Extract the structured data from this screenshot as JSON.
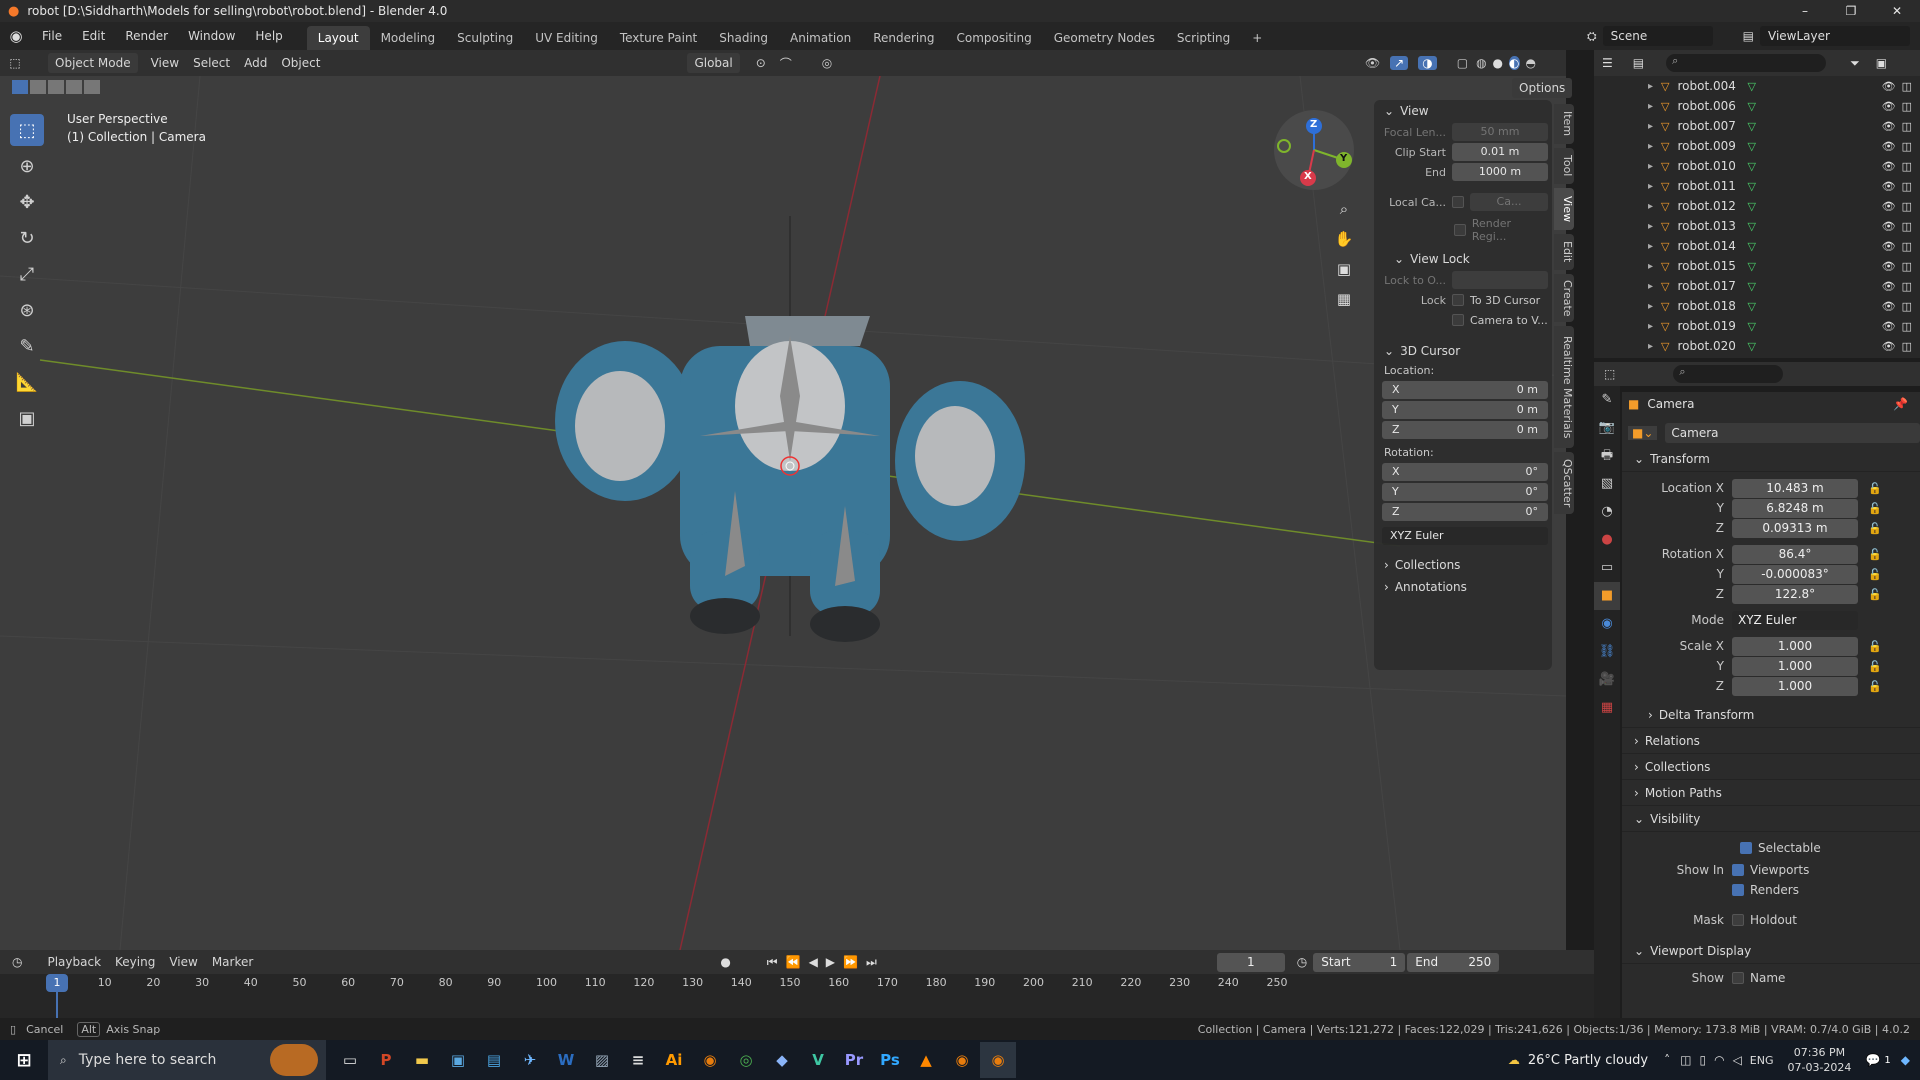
{
  "window": {
    "title": "robot [D:\\Siddharth\\Models for selling\\robot\\robot.blend] - Blender 4.0",
    "minimize": "–",
    "maximize": "❐",
    "close": "✕"
  },
  "menu": {
    "items": [
      "File",
      "Edit",
      "Render",
      "Window",
      "Help"
    ]
  },
  "workspaces": [
    "Layout",
    "Modeling",
    "Sculpting",
    "UV Editing",
    "Texture Paint",
    "Shading",
    "Animation",
    "Rendering",
    "Compositing",
    "Geometry Nodes",
    "Scripting",
    "+"
  ],
  "scene": {
    "label": "Scene",
    "viewlayer": "ViewLayer"
  },
  "viewport_header": {
    "mode": "Object Mode",
    "view": "View",
    "select": "Select",
    "add": "Add",
    "object": "Object",
    "orientation": "Global",
    "options": "Options"
  },
  "viewport": {
    "perspective": "User Perspective",
    "context": "(1) Collection | Camera"
  },
  "gizmo": {
    "z": "Z",
    "y": "Y",
    "x": "X"
  },
  "npanel": {
    "tabs": [
      "Item",
      "Tool",
      "View",
      "Edit",
      "Create",
      "Realtime Materials",
      "QScatter"
    ],
    "view_header": "View",
    "focal_label": "Focal Len...",
    "focal_value": "50 mm",
    "clip_start_label": "Clip Start",
    "clip_start_value": "0.01 m",
    "end_label": "End",
    "end_value": "1000 m",
    "local_cam_label": "Local Ca...",
    "local_cam_value": "Ca...",
    "render_region": "Render Regi...",
    "view_lock_header": "View Lock",
    "lock_to_label": "Lock to O...",
    "lock_label": "Lock",
    "to_cursor": "To 3D Cursor",
    "camera_to_view": "Camera to V...",
    "cursor_header": "3D Cursor",
    "location_label": "Location:",
    "loc": {
      "x_label": "X",
      "x": "0 m",
      "y_label": "Y",
      "y": "0 m",
      "z_label": "Z",
      "z": "0 m"
    },
    "rotation_label": "Rotation:",
    "rot": {
      "x_label": "X",
      "x": "0°",
      "y_label": "Y",
      "y": "0°",
      "z_label": "Z",
      "z": "0°"
    },
    "rot_mode": "XYZ Euler",
    "collections": "Collections",
    "annotations": "Annotations"
  },
  "outliner": {
    "items": [
      "robot.004",
      "robot.006",
      "robot.007",
      "robot.009",
      "robot.010",
      "robot.011",
      "robot.012",
      "robot.013",
      "robot.014",
      "robot.015",
      "robot.017",
      "robot.018",
      "robot.019",
      "robot.020"
    ]
  },
  "properties": {
    "object_name": "Camera",
    "data_name": "Camera",
    "transform_header": "Transform",
    "location_x_label": "Location X",
    "location_x": "10.483 m",
    "location_y_label": "Y",
    "location_y": "6.8248 m",
    "location_z_label": "Z",
    "location_z": "0.09313 m",
    "rotation_x_label": "Rotation X",
    "rotation_x": "86.4°",
    "rotation_y_label": "Y",
    "rotation_y": "-0.000083°",
    "rotation_z_label": "Z",
    "rotation_z": "122.8°",
    "mode_label": "Mode",
    "mode": "XYZ Euler",
    "scale_x_label": "Scale X",
    "scale_x": "1.000",
    "scale_y_label": "Y",
    "scale_y": "1.000",
    "scale_z_label": "Z",
    "scale_z": "1.000",
    "delta_transform": "Delta Transform",
    "relations": "Relations",
    "collections": "Collections",
    "motion_paths": "Motion Paths",
    "visibility": "Visibility",
    "selectable": "Selectable",
    "show_in_label": "Show In",
    "viewports": "Viewports",
    "renders": "Renders",
    "mask_label": "Mask",
    "holdout": "Holdout",
    "viewport_display": "Viewport Display",
    "show_label": "Show",
    "name": "Name"
  },
  "timeline": {
    "playback": "Playback",
    "keying": "Keying",
    "view": "View",
    "marker": "Marker",
    "current_frame": "1",
    "start_label": "Start",
    "start": "1",
    "end_label": "End",
    "end": "250",
    "ticks": [
      "1",
      "10",
      "20",
      "30",
      "40",
      "50",
      "60",
      "70",
      "80",
      "90",
      "100",
      "110",
      "120",
      "130",
      "140",
      "150",
      "160",
      "170",
      "180",
      "190",
      "200",
      "210",
      "220",
      "230",
      "240",
      "250"
    ]
  },
  "status": {
    "cancel": "Cancel",
    "alt": "Alt",
    "axis_snap": "Axis Snap",
    "stats": "Collection | Camera | Verts:121,272 | Faces:122,029 | Tris:241,626 | Objects:1/36 | Memory: 173.8 MiB | VRAM: 0.7/4.0 GiB | 4.0.2"
  },
  "taskbar": {
    "search_placeholder": "Type here to search",
    "weather": "26°C  Partly cloudy",
    "lang": "ENG",
    "time": "07:36 PM",
    "date": "07-03-2024",
    "notif": "1"
  }
}
